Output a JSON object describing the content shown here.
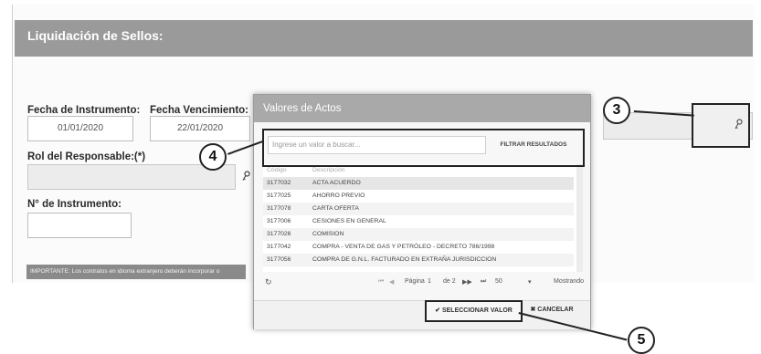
{
  "header": {
    "title": "Liquidación de Sellos:"
  },
  "form": {
    "fecha_instrumento_label": "Fecha de Instrumento:",
    "fecha_instrumento_value": "01/01/2020",
    "fecha_vencimiento_label": "Fecha Vencimiento:",
    "fecha_vencimiento_value": "22/01/2020",
    "rol_label": "Rol del Responsable:(*)",
    "numero_label": "N° de Instrumento:",
    "notice": "IMPORTANTE: Los contratos en idioma extranjero deberán incorporar o"
  },
  "modal": {
    "title": "Valores de Actos",
    "search_placeholder": "Ingrese un valor a buscar...",
    "filter_button": "FILTRAR RESULTADOS",
    "column_code": "Código",
    "column_name": "Descripción",
    "rows": [
      {
        "code": "3177032",
        "name": "ACTA ACUERDO"
      },
      {
        "code": "3177025",
        "name": "AHORRO PREVIO"
      },
      {
        "code": "3177078",
        "name": "CARTA OFERTA"
      },
      {
        "code": "3177006",
        "name": "CESIONES EN GENERAL"
      },
      {
        "code": "3177026",
        "name": "COMISION"
      },
      {
        "code": "3177042",
        "name": "COMPRA - VENTA DE GAS Y PETRÓLEO - DECRETO 786/1998"
      },
      {
        "code": "3177056",
        "name": "COMPRA DE G.N.L. FACTURADO EN EXTRAÑA JURISDICCION"
      }
    ],
    "pager": {
      "page_label": "Página",
      "page_value": "1",
      "of_label": "de 2",
      "per_page": "50",
      "showing": "Mostrando"
    },
    "select_button": "✔ SELECCIONAR VALOR",
    "cancel_button": "✖ CANCELAR"
  },
  "callouts": {
    "c3": "3",
    "c4": "4",
    "c5": "5"
  }
}
